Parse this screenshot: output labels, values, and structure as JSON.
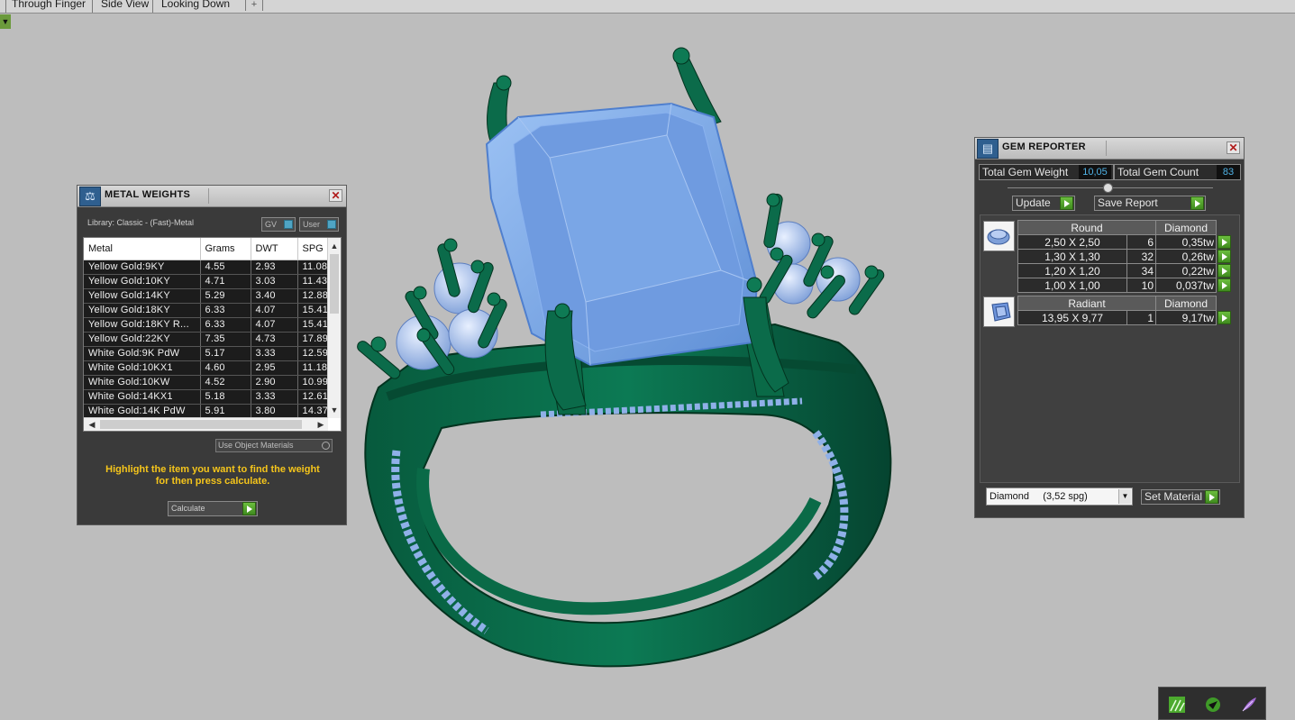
{
  "view_tabs": [
    "Through Finger",
    "Side View",
    "Looking Down"
  ],
  "add_tab_symbol": "+",
  "view_menu_symbol": "▼",
  "metal_weights": {
    "title": "METAL WEIGHTS",
    "library_label": "Library: Classic - (Fast)-Metal",
    "gv_label": "GV",
    "user_label": "User",
    "columns": [
      "Metal",
      "Grams",
      "DWT",
      "SPG"
    ],
    "rows": [
      [
        "Yellow Gold:9KY",
        "4.55",
        "2.93",
        "11.08"
      ],
      [
        "Yellow Gold:10KY",
        "4.71",
        "3.03",
        "11.43"
      ],
      [
        "Yellow Gold:14KY",
        "5.29",
        "3.40",
        "12.88"
      ],
      [
        "Yellow Gold:18KY",
        "6.33",
        "4.07",
        "15.41"
      ],
      [
        "Yellow Gold:18KY R...",
        "6.33",
        "4.07",
        "15.41"
      ],
      [
        "Yellow Gold:22KY",
        "7.35",
        "4.73",
        "17.89"
      ],
      [
        "White Gold:9K PdW",
        "5.17",
        "3.33",
        "12.59"
      ],
      [
        "White Gold:10KX1",
        "4.60",
        "2.95",
        "11.18"
      ],
      [
        "White Gold:10KW",
        "4.52",
        "2.90",
        "10.99"
      ],
      [
        "White Gold:14KX1",
        "5.18",
        "3.33",
        "12.61"
      ],
      [
        "White Gold:14K PdW",
        "5.91",
        "3.80",
        "14.37"
      ]
    ],
    "use_object_materials": "Use Object Materials",
    "instruction_line1": "Highlight the item you want to find the weight",
    "instruction_line2": "for then press calculate.",
    "calculate_label": "Calculate",
    "close_symbol": "✕"
  },
  "gem_reporter": {
    "title": "GEM REPORTER",
    "total_weight_label": "Total Gem Weight",
    "total_weight_value": "10,05",
    "total_count_label": "Total Gem Count",
    "total_count_value": "83",
    "update_label": "Update",
    "save_report_label": "Save Report",
    "groups": [
      {
        "cut": "Round",
        "material": "Diamond",
        "icon": "round-gem-icon",
        "rows": [
          [
            "2,50 X 2,50",
            "6",
            "0,35tw"
          ],
          [
            "1,30 X 1,30",
            "32",
            "0,26tw"
          ],
          [
            "1,20 X 1,20",
            "34",
            "0,22tw"
          ],
          [
            "1,00 X 1,00",
            "10",
            "0,037tw"
          ]
        ]
      },
      {
        "cut": "Radiant",
        "material": "Diamond",
        "icon": "radiant-gem-icon",
        "rows": [
          [
            "13,95 X 9,77",
            "1",
            "9,17tw"
          ]
        ]
      }
    ],
    "material_select": "Diamond     (3,52 spg)",
    "set_material_label": "Set Material",
    "close_symbol": "✕"
  },
  "colors": {
    "metal": "#0b6b4a",
    "metal_dark": "#053d2a",
    "gem": "#7aa7e6",
    "instruction": "#f5c51b",
    "value_text": "#4fb2e6"
  }
}
